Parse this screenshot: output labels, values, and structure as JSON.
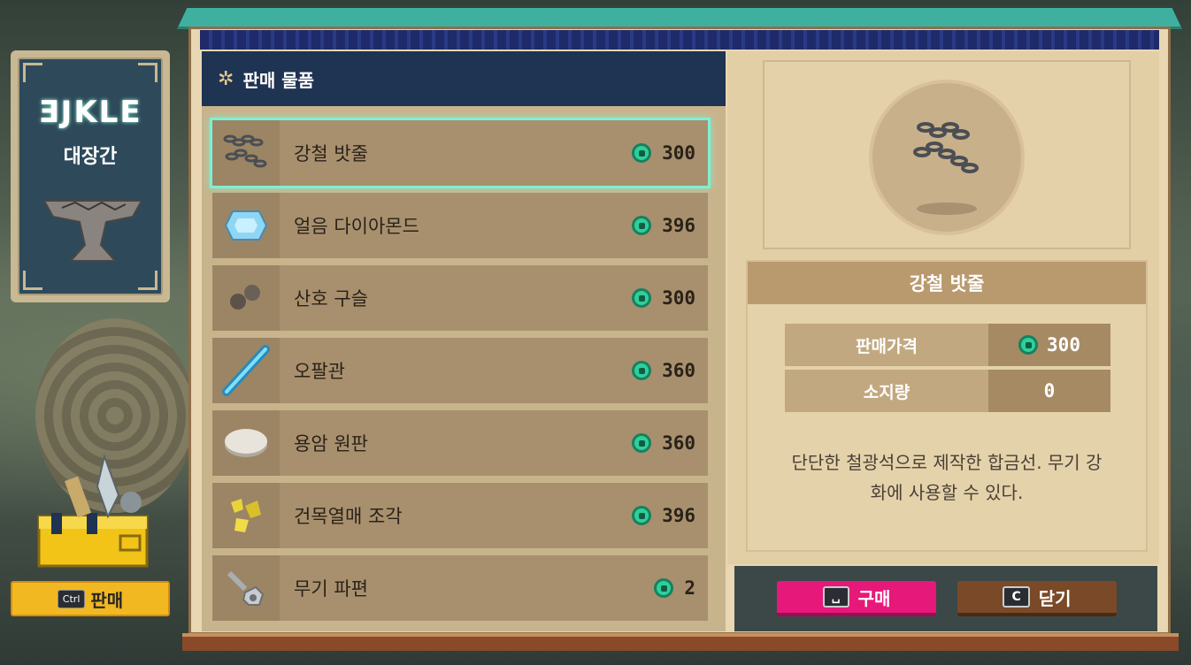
{
  "shop": {
    "rune_title": "ƎJKLE",
    "name": "대장간"
  },
  "side": {
    "sell_key": "Ctrl",
    "sell_label": "판매"
  },
  "left": {
    "title": "판매 물품",
    "items": [
      {
        "name": "강철 밧줄",
        "price": "300",
        "icon": "steel-rope-icon"
      },
      {
        "name": "얼음 다이아몬드",
        "price": "396",
        "icon": "ice-diamond-icon"
      },
      {
        "name": "산호 구슬",
        "price": "300",
        "icon": "coral-bead-icon"
      },
      {
        "name": "오팔관",
        "price": "360",
        "icon": "opal-tube-icon"
      },
      {
        "name": "용암 원판",
        "price": "360",
        "icon": "lava-disc-icon"
      },
      {
        "name": "건목열매 조각",
        "price": "396",
        "icon": "dry-fruit-piece-icon"
      },
      {
        "name": "무기 파편",
        "price": "2",
        "icon": "weapon-fragment-icon"
      }
    ]
  },
  "detail": {
    "name": "강철 밧줄",
    "price_label": "판매가격",
    "price": "300",
    "owned_label": "소지량",
    "owned": "0",
    "description_line1": "단단한 철광석으로 제작한 합금선. 무기 강",
    "description_line2": "화에 사용할 수 있다."
  },
  "buttons": {
    "buy_key": "␣",
    "buy_label": "구매",
    "close_key": "C",
    "close_label": "닫기"
  },
  "colors": {
    "accent_teal": "#7ef0d4",
    "buy_pink": "#e6197a",
    "close_brown": "#7a4a28",
    "header_navy": "#1f3352"
  }
}
